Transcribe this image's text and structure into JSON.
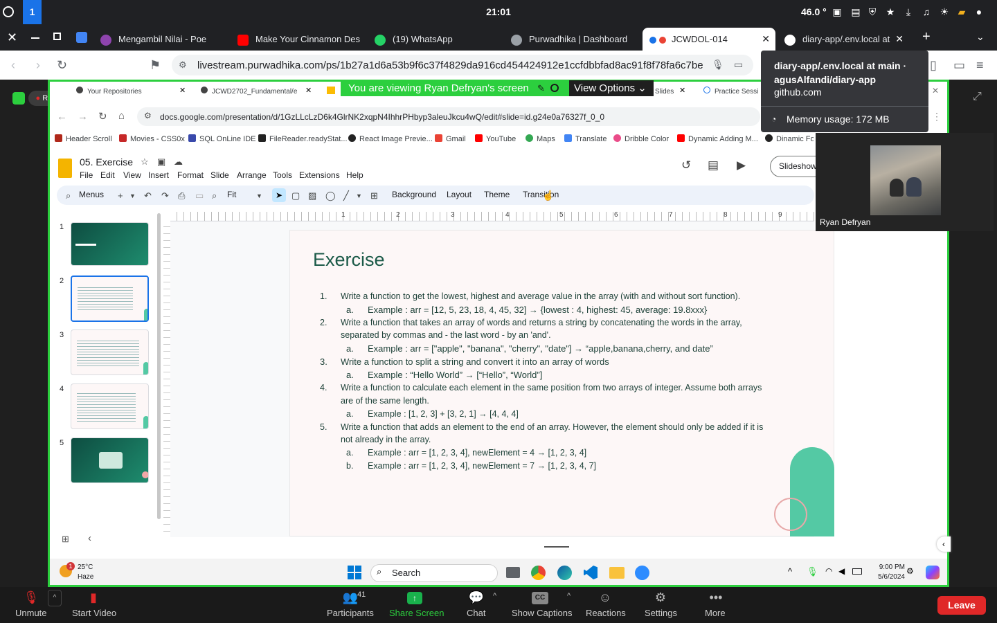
{
  "system": {
    "workspace": "1",
    "clock": "21:01",
    "temperature": "46.0 °"
  },
  "tabs": [
    {
      "label": "Mengambil Nilai - Poe",
      "color": "#8e44ad"
    },
    {
      "label": "Make Your Cinnamon Des",
      "color": "#ff0000"
    },
    {
      "label": "(19) WhatsApp",
      "color": "#25d366"
    },
    {
      "label": "Purwadhika | Dashboard",
      "color": "#5f6368"
    },
    {
      "label": "JCWDOL-014",
      "color": "#1a73e8"
    },
    {
      "label": "diary-app/.env.local at",
      "color": "#202124"
    }
  ],
  "address": {
    "url": "livestream.purwadhika.com/ps/1b27a1d6a53b9f6c37f4829da916cd454424912e1ccfdbbfad8ac91f8f78fa6c7be16..."
  },
  "tooltip": {
    "title": "diary-app/.env.local at main · agusAlfandi/diary-app",
    "domain": "github.com",
    "memory": "Memory usage: 172 MB"
  },
  "zoom_share": {
    "viewing": "You are viewing Ryan Defryan's screen",
    "view_options": "View Options",
    "rec": "REC"
  },
  "inner_browser": {
    "tabs": [
      "Your Repositories",
      "JCWD2702_Fundamental/e",
      "Slides",
      "Practice Sessi"
    ],
    "url": "docs.google.com/presentation/d/1GzLLcLzD6k4GlrNK2xqpN4IhhrPHbyp3aleuJkcu4wQ/edit#slide=id.g24e0a76327f_0_0",
    "bookmarks": [
      {
        "label": "Header Scroll",
        "color": "#b0281a"
      },
      {
        "label": "Movies - CSS0x",
        "color": "#c62828"
      },
      {
        "label": "SQL OnLine IDE",
        "color": "#3949ab"
      },
      {
        "label": "FileReader.readyStat...",
        "color": "#222222"
      },
      {
        "label": "React Image Previe...",
        "color": "#222222"
      },
      {
        "label": "Gmail",
        "color": "#ea4335"
      },
      {
        "label": "YouTube",
        "color": "#ff0000"
      },
      {
        "label": "Maps",
        "color": "#34a853"
      },
      {
        "label": "Translate",
        "color": "#4285f4"
      },
      {
        "label": "Dribble Color",
        "color": "#ea4c89"
      },
      {
        "label": "Dynamic Adding M...",
        "color": "#ff0000"
      },
      {
        "label": "Dinamic Form",
        "color": "#222222"
      }
    ]
  },
  "slides_app": {
    "doc_title": "05. Exercise",
    "menus": [
      "File",
      "Edit",
      "View",
      "Insert",
      "Format",
      "Slide",
      "Arrange",
      "Tools",
      "Extensions",
      "Help"
    ],
    "toolbar": {
      "menus": "Menus",
      "zoom": "Fit",
      "background": "Background",
      "layout": "Layout",
      "theme": "Theme",
      "transition": "Transition"
    },
    "slideshow": "Slideshow",
    "thumbnails": [
      "1",
      "2",
      "3",
      "4",
      "5"
    ],
    "ruler": [
      "1",
      "2",
      "3",
      "4",
      "5",
      "6",
      "7",
      "8",
      "9"
    ]
  },
  "slide": {
    "title": "Exercise",
    "lines": [
      {
        "n": "1.",
        "text": "Write a function to get the lowest, highest and average value in the array (with and without sort function)."
      },
      {
        "n": "a.",
        "text": "Example : arr = [12, 5, 23, 18, 4, 45, 32] → {lowest : 4, highest: 45, average: 19.8xxx}"
      },
      {
        "n": "2.",
        "text": "Write a function that takes an array of words and returns a string by concatenating the words in the array,"
      },
      {
        "n": "",
        "text": "separated by commas and - the last word - by an 'and'."
      },
      {
        "n": "a.",
        "text": "Example : arr =  [\"apple\", \"banana\", \"cherry\", \"date\"] → “apple,banana,cherry, and date”"
      },
      {
        "n": "3.",
        "text": "Write a function to split a string and convert it into an array of words"
      },
      {
        "n": "a.",
        "text": "Example : “Hello World” → [“Hello”, “World”]"
      },
      {
        "n": "4.",
        "text": "Write a function to calculate each element in the same position from two arrays of integer. Assume both arrays"
      },
      {
        "n": "",
        "text": "are of the same length."
      },
      {
        "n": "a.",
        "text": "Example : [1, 2, 3] + [3, 2, 1] → [4, 4, 4]"
      },
      {
        "n": "5.",
        "text": "Write a function that adds an element to the end of an array. However, the element should only be added if it is"
      },
      {
        "n": "",
        "text": "not already in the array."
      },
      {
        "n": "a.",
        "text": "Example : arr = [1, 2, 3, 4], newElement = 4   →   [1, 2, 3, 4]"
      },
      {
        "n": "b.",
        "text": "Example : arr = [1, 2, 3, 4], newElement = 7   →   [1, 2, 3, 4, 7]"
      }
    ]
  },
  "participant": {
    "name": "Ryan Defryan"
  },
  "taskbar": {
    "weather_temp": "25°C",
    "weather_desc": "Haze",
    "weather_badge": "1",
    "search": "Search",
    "time": "9:00 PM",
    "date": "5/6/2024"
  },
  "zoom_controls": {
    "unmute": "Unmute",
    "start_video": "Start Video",
    "participants": "Participants",
    "participants_count": "41",
    "share_screen": "Share Screen",
    "chat": "Chat",
    "captions": "Show Captions",
    "reactions": "Reactions",
    "settings": "Settings",
    "more": "More",
    "leave": "Leave"
  }
}
